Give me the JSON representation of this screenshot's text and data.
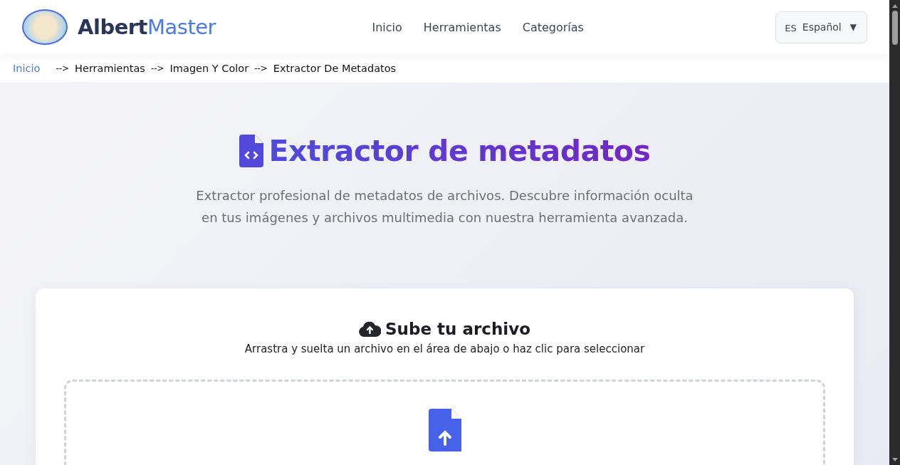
{
  "header": {
    "logo": {
      "text_dark": "Albert",
      "text_accent": "Master"
    },
    "nav": [
      {
        "label": "Inicio"
      },
      {
        "label": "Herramientas"
      },
      {
        "label": "Categorías"
      }
    ],
    "language": {
      "code": "ES",
      "label": "Español",
      "caret": "▼"
    }
  },
  "breadcrumb": [
    {
      "kind": "link",
      "label": "Inicio"
    },
    {
      "kind": "separator",
      "label": "-->"
    },
    {
      "kind": "text",
      "label": "Herramientas"
    },
    {
      "kind": "separator",
      "label": "-->"
    },
    {
      "kind": "text",
      "label": "Imagen Y Color"
    },
    {
      "kind": "separator",
      "label": "-->"
    },
    {
      "kind": "text",
      "label": "Extractor De Metadatos"
    }
  ],
  "hero": {
    "title": "Extractor de metadatos",
    "description": "Extractor profesional de metadatos de archivos. Descubre información oculta en tus imágenes y archivos multimedia con nuestra herramienta avanzada."
  },
  "upload": {
    "title": "Sube tu archivo",
    "subtitle": "Arrastra y suelta un archivo en el área de abajo o haz clic para seleccionar"
  }
}
